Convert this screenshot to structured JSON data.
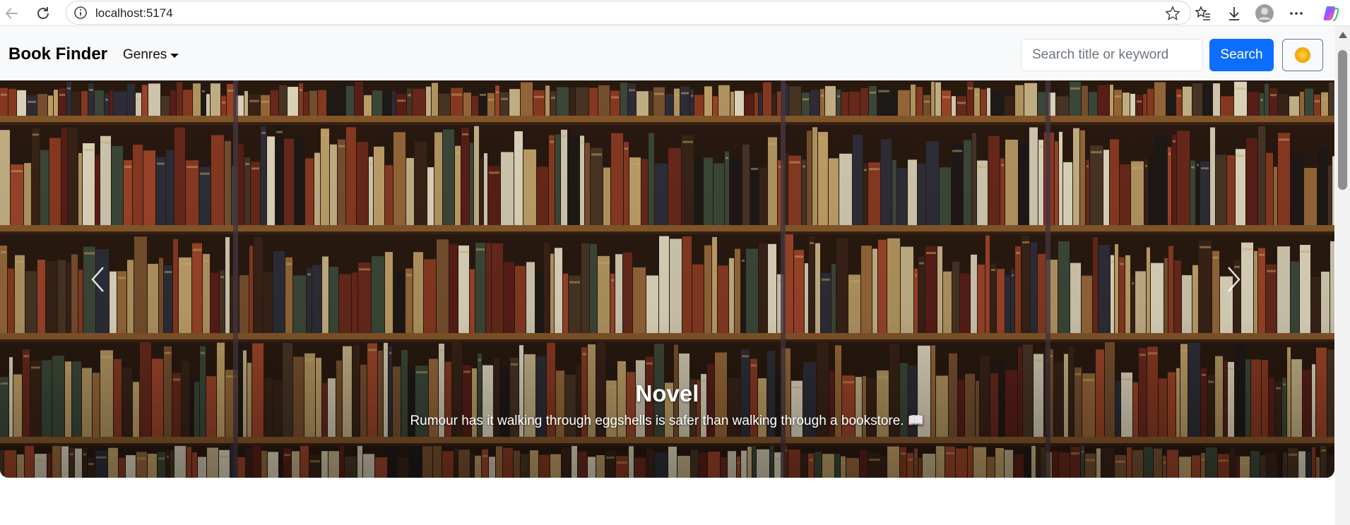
{
  "browser": {
    "url": "localhost:5174"
  },
  "navbar": {
    "brand": "Book Finder",
    "genres_label": "Genres",
    "search_placeholder": "Search title or keyword",
    "search_button": "Search",
    "theme_icon": "sun-icon"
  },
  "carousel": {
    "title": "Novel",
    "text": "Rumour has it walking through eggshells is safer than walking through a bookstore. 📖",
    "prev_icon": "chevron-left-icon",
    "next_icon": "chevron-right-icon"
  },
  "colors": {
    "primary": "#0d6efd",
    "navbar_bg": "#f8f9fa",
    "shelf_wood": "#8a5a2b"
  }
}
